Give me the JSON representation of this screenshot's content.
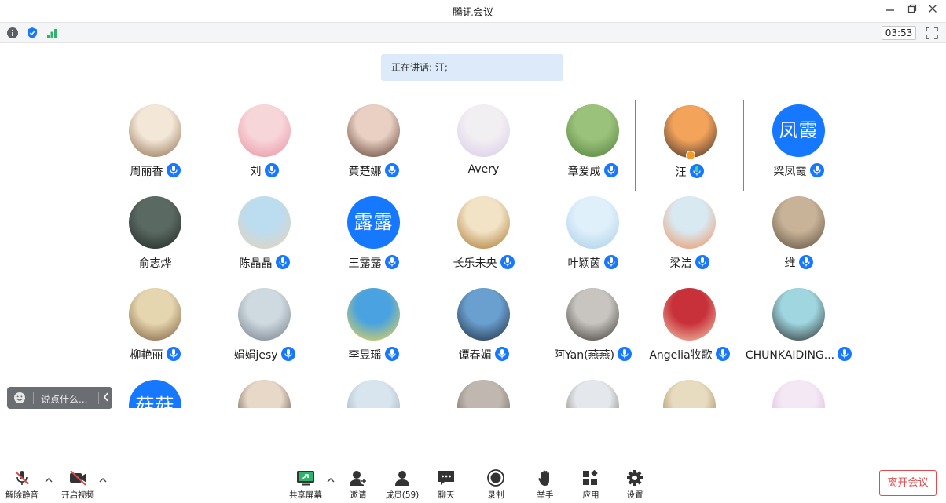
{
  "window": {
    "title": "腾讯会议"
  },
  "statusbar": {
    "timer": "03:53"
  },
  "speaking": {
    "text": "正在讲话: 汪;"
  },
  "participants": [
    {
      "name": "周丽香",
      "mic": true
    },
    {
      "name": "刘",
      "mic": true
    },
    {
      "name": "黄楚娜",
      "mic": true
    },
    {
      "name": "Avery",
      "mic": false
    },
    {
      "name": "章爱成",
      "mic": true
    },
    {
      "name": "汪",
      "mic": true,
      "active": true,
      "host": true
    },
    {
      "name": "梁凤霞",
      "mic": true,
      "avatar_text": "凤霞"
    },
    {
      "name": "俞志烨",
      "mic": false
    },
    {
      "name": "陈晶晶",
      "mic": true
    },
    {
      "name": "王露露",
      "mic": true,
      "avatar_text": "露露"
    },
    {
      "name": "长乐未央",
      "mic": true
    },
    {
      "name": "叶颖茵",
      "mic": true
    },
    {
      "name": "梁洁",
      "mic": true
    },
    {
      "name": "维",
      "mic": true
    },
    {
      "name": "柳艳丽",
      "mic": true
    },
    {
      "name": "娟娟jesy",
      "mic": true
    },
    {
      "name": "李昱瑶",
      "mic": true
    },
    {
      "name": "谭春媚",
      "mic": true
    },
    {
      "name": "阿Yan(燕燕)",
      "mic": true
    },
    {
      "name": "Angelia牧歌",
      "mic": true
    },
    {
      "name": "CHUNKAIDING...",
      "mic": true
    }
  ],
  "partial_row": [
    {
      "avatar_text": "菇菇"
    },
    {},
    {},
    {},
    {},
    {},
    {}
  ],
  "chat": {
    "placeholder": "说点什么..."
  },
  "toolbar": {
    "unmute": "解除静音",
    "video": "开启视频",
    "share": "共享屏幕",
    "invite": "邀请",
    "members": "成员(59)",
    "chat": "聊天",
    "record": "录制",
    "raise_hand": "举手",
    "apps": "应用",
    "settings": "设置",
    "leave": "离开会议"
  },
  "colors": {
    "accent": "#1677ff",
    "active_border": "#32b06b",
    "leave": "#e24b4b"
  }
}
